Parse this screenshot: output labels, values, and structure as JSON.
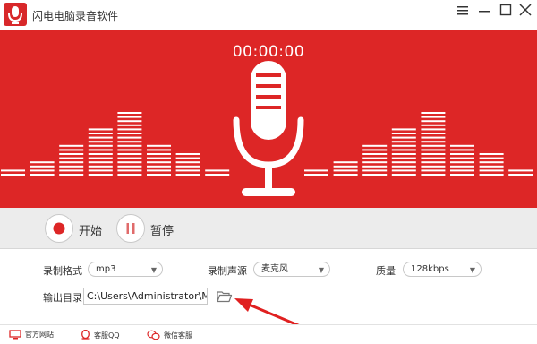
{
  "titlebar": {
    "title": "闪电电脑录音软件",
    "icons": [
      "app-mic-logo-icon",
      "menu-icon",
      "minimize-icon",
      "maximize-icon",
      "close-icon"
    ]
  },
  "recorder": {
    "timer": "00:00:00",
    "accent_color": "#dd2626",
    "equalizer_levels_left": [
      1,
      2,
      4,
      6,
      8,
      4,
      3,
      1
    ],
    "equalizer_levels_right": [
      1,
      2,
      4,
      6,
      8,
      4,
      3,
      1
    ]
  },
  "controls": {
    "start_label": "开始",
    "pause_label": "暂停"
  },
  "settings": {
    "format_label": "录制格式",
    "format_value": "mp3",
    "source_label": "录制声源",
    "source_value": "麦克风",
    "quality_label": "质量",
    "quality_value": "128kbps",
    "output_label": "输出目录",
    "output_path": "C:\\Users\\Administrator\\Music"
  },
  "footer": {
    "website_label": "官方网站",
    "qq_label": "客服QQ",
    "wechat_label": "微信客服"
  }
}
